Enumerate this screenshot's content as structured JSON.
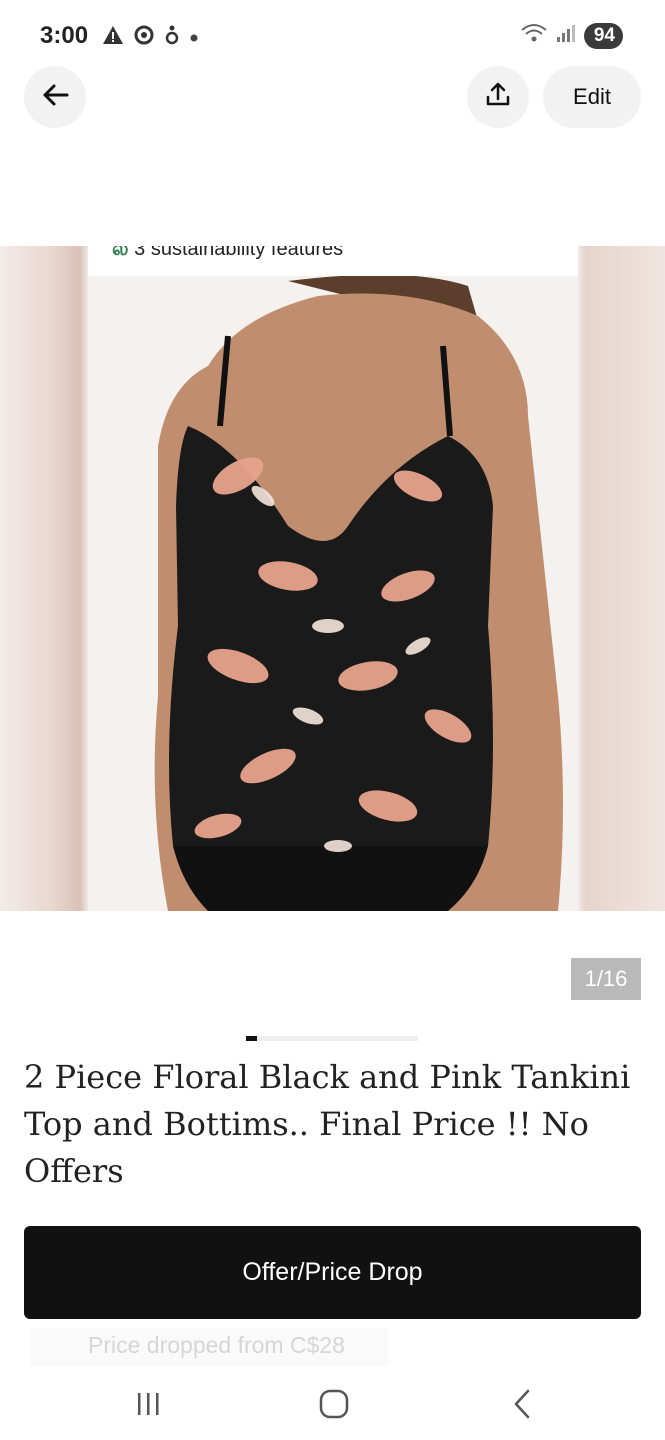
{
  "status_bar": {
    "time": "3:00",
    "battery": "94",
    "left_icons": [
      "warning-icon",
      "chrome-icon",
      "accessibility-icon",
      "dot-icon"
    ],
    "right_icons": [
      "wifi-icon",
      "signal-icon"
    ]
  },
  "header": {
    "edit_label": "Edit",
    "back_icon": "arrow-left-icon",
    "share_icon": "share-icon"
  },
  "gallery": {
    "sustainability_text": "3 sustainability features",
    "counter": "1/16",
    "progress_fraction": 0.0625
  },
  "product": {
    "title": "2 Piece Floral Black and Pink Tankini Top and Bottims.. Final Price !! No Offers",
    "price_drop_text": "Price dropped from C$28"
  },
  "actions": {
    "offer_button_label": "Offer/Price Drop"
  },
  "colors": {
    "primary_button": "#111111",
    "floral_pink": "#e8a48c",
    "swimsuit_black": "#1a1a1a"
  },
  "nav": {
    "items": [
      "recent-apps-icon",
      "home-icon",
      "back-icon"
    ]
  }
}
